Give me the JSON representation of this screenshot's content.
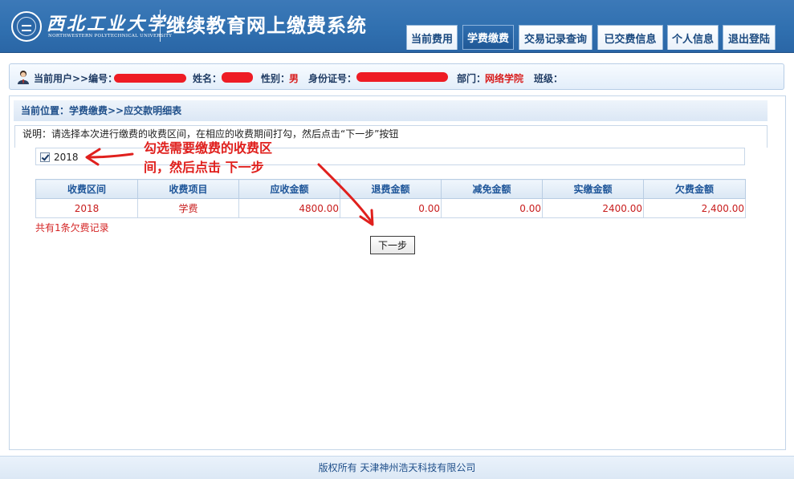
{
  "header": {
    "university_name": "西北工业大学",
    "university_name_en": "NORTHWESTERN POLYTECHNICAL UNIVERSITY",
    "system_title": "继续教育网上缴费系统",
    "nav": [
      {
        "label": "当前费用",
        "active": false
      },
      {
        "label": "学费缴费",
        "active": true
      },
      {
        "label": "交易记录查询",
        "active": false
      },
      {
        "label": "已交费信息",
        "active": false
      },
      {
        "label": "个人信息",
        "active": false
      },
      {
        "label": "退出登陆",
        "active": false
      }
    ]
  },
  "user_bar": {
    "current_user_label": "当前用户>>编号：",
    "name_label": "姓名：",
    "gender_label": "性别：",
    "gender_value": "男",
    "id_label": "身份证号：",
    "dept_label": "部门：",
    "dept_value": "网络学院",
    "class_label": "班级："
  },
  "location": "当前位置：学费缴费>>应交款明细表",
  "note": "说明：请选择本次进行缴费的收费区间，在相应的收费期间打勾，然后点击“下一步”按钮",
  "period": {
    "label": "2018",
    "checked": true
  },
  "annotation": {
    "line1": "勾选需要缴费的收费区",
    "line2": "间，然后点击  下一步",
    "color": "#e0201d"
  },
  "table": {
    "headers": [
      "收费区间",
      "收费项目",
      "应收金额",
      "退费金额",
      "减免金额",
      "实缴金额",
      "欠费金额"
    ],
    "rows": [
      [
        "2018",
        "学费",
        "4800.00",
        "0.00",
        "0.00",
        "2400.00",
        "2,400.00"
      ]
    ]
  },
  "summary": "共有1条欠费记录",
  "next_button": "下一步",
  "footer": "版权所有 天津神州浩天科技有限公司",
  "colors": {
    "header_blue": "#3070b0",
    "accent_red": "#d81e1e",
    "heading_blue": "#1d5599"
  }
}
